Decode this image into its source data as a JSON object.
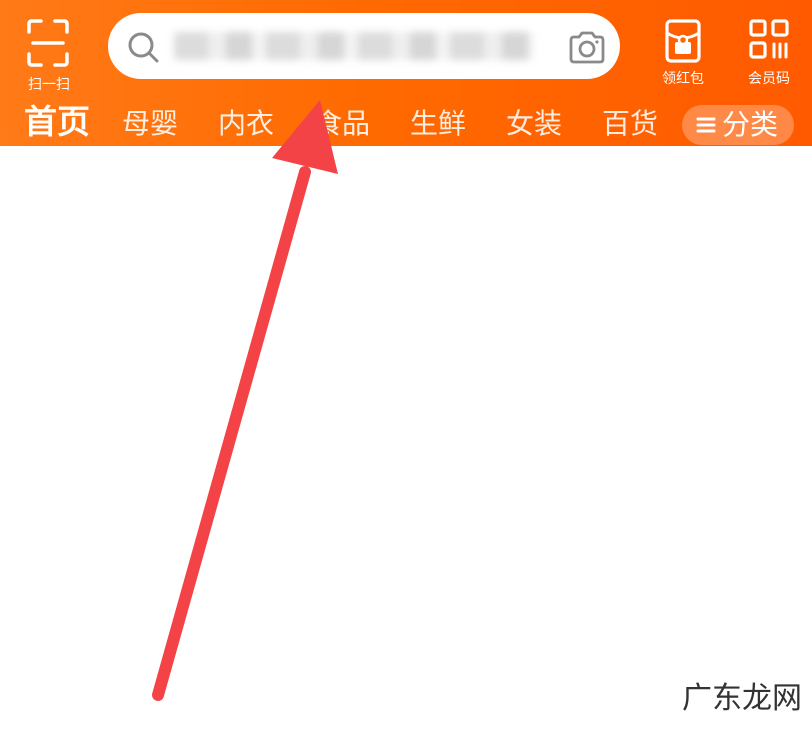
{
  "header": {
    "scan_label": "扫一扫",
    "search_placeholder": "",
    "red_packet_label": "领红包",
    "member_code_label": "会员码"
  },
  "tabs": [
    {
      "label": "首页",
      "active": true
    },
    {
      "label": "母婴"
    },
    {
      "label": "内衣"
    },
    {
      "label": "食品"
    },
    {
      "label": "生鲜"
    },
    {
      "label": "女装"
    },
    {
      "label": "百货"
    }
  ],
  "category_button": {
    "label": "分类"
  },
  "watermark": "广东龙网",
  "colors": {
    "header_start": "#ff7a18",
    "header_end": "#ff5a00",
    "arrow": "#f44346"
  },
  "icons": [
    "scan-icon",
    "search-icon",
    "camera-icon",
    "red-packet-icon",
    "member-code-icon",
    "menu-icon"
  ]
}
